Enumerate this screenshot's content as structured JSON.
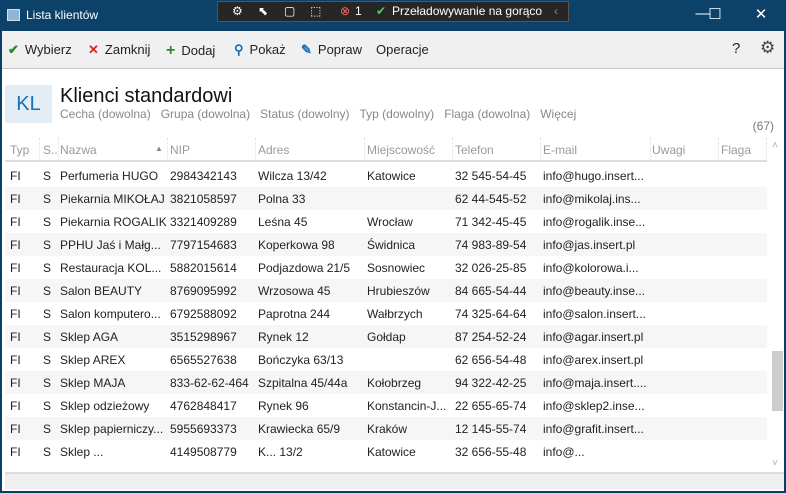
{
  "window": {
    "title": "Lista klientów",
    "devbar": {
      "badge": "1",
      "hot_reload": "Przeładowywanie na gorąco"
    }
  },
  "toolbar": {
    "select": "Wybierz",
    "close": "Zamknij",
    "add": "Dodaj",
    "show": "Pokaż",
    "edit": "Popraw",
    "operations": "Operacje",
    "help": "?"
  },
  "header": {
    "badge": "KL",
    "title": "Klienci standardowi",
    "filters": [
      "Cecha (dowolna)",
      "Grupa (dowolna)",
      "Status (dowolny)",
      "Typ (dowolny)",
      "Flaga (dowolna)",
      "Więcej"
    ],
    "count": "(67)"
  },
  "columns": [
    "Typ",
    "S..",
    "Nazwa",
    "NIP",
    "Adres",
    "Miejscowość",
    "Telefon",
    "E-mail",
    "Uwagi",
    "Flaga"
  ],
  "rows": [
    [
      "FI",
      "S",
      "Perfumeria HUGO",
      "2984342143",
      "Wilcza  13/42",
      "Katowice",
      "32 545-54-45",
      "info@hugo.insert..."
    ],
    [
      "FI",
      "S",
      "Piekarnia MIKOŁAJ",
      "3821058597",
      "Polna  33",
      "",
      "62 44-545-52",
      "info@mikolaj.ins..."
    ],
    [
      "FI",
      "S",
      "Piekarnia ROGALIK",
      "3321409289",
      "Leśna  45",
      "Wrocław",
      "71 342-45-45",
      "info@rogalik.inse..."
    ],
    [
      "FI",
      "S",
      "PPHU Jaś i Małg...",
      "7797154683",
      "Koperkowa  98",
      "Świdnica",
      "74 983-89-54",
      "info@jas.insert.pl"
    ],
    [
      "FI",
      "S",
      "Restauracja KOL...",
      "5882015614",
      "Podjazdowa  21/5",
      "Sosnowiec",
      "32 026-25-85",
      "info@kolorowa.i..."
    ],
    [
      "FI",
      "S",
      "Salon BEAUTY",
      "8769095992",
      "Wrzosowa  45",
      "Hrubieszów",
      "84 665-54-44",
      "info@beauty.inse..."
    ],
    [
      "FI",
      "S",
      "Salon komputero...",
      "6792588092",
      "Paprotna  244",
      "Wałbrzych",
      "74 325-64-64",
      "info@salon.insert..."
    ],
    [
      "FI",
      "S",
      "Sklep AGA",
      "3515298967",
      "Rynek 12",
      "Gołdap",
      "87 254-52-24",
      "info@agar.insert.pl"
    ],
    [
      "FI",
      "S",
      "Sklep AREX",
      "6565527638",
      "Bończyka  63/13",
      "",
      "62 656-54-48",
      "info@arex.insert.pl"
    ],
    [
      "FI",
      "S",
      "Sklep MAJA",
      "833-62-62-464",
      "Szpitalna  45/44a",
      "Kołobrzeg",
      "94 322-42-25",
      "info@maja.insert...."
    ],
    [
      "FI",
      "S",
      "Sklep odzieżowy",
      "4762848417",
      "Rynek  96",
      "Konstancin-J...",
      "22 655-65-74",
      "info@sklep2.inse..."
    ],
    [
      "FI",
      "S",
      "Sklep papierniczy...",
      "5955693373",
      "Krawiecka  65/9",
      "Kraków",
      "12 145-55-74",
      "info@grafit.insert..."
    ],
    [
      "FI",
      "S",
      "Sklep ...",
      "4149508779",
      "K...  13/2",
      "Katowice",
      "32 656-55-48",
      "info@..."
    ]
  ]
}
